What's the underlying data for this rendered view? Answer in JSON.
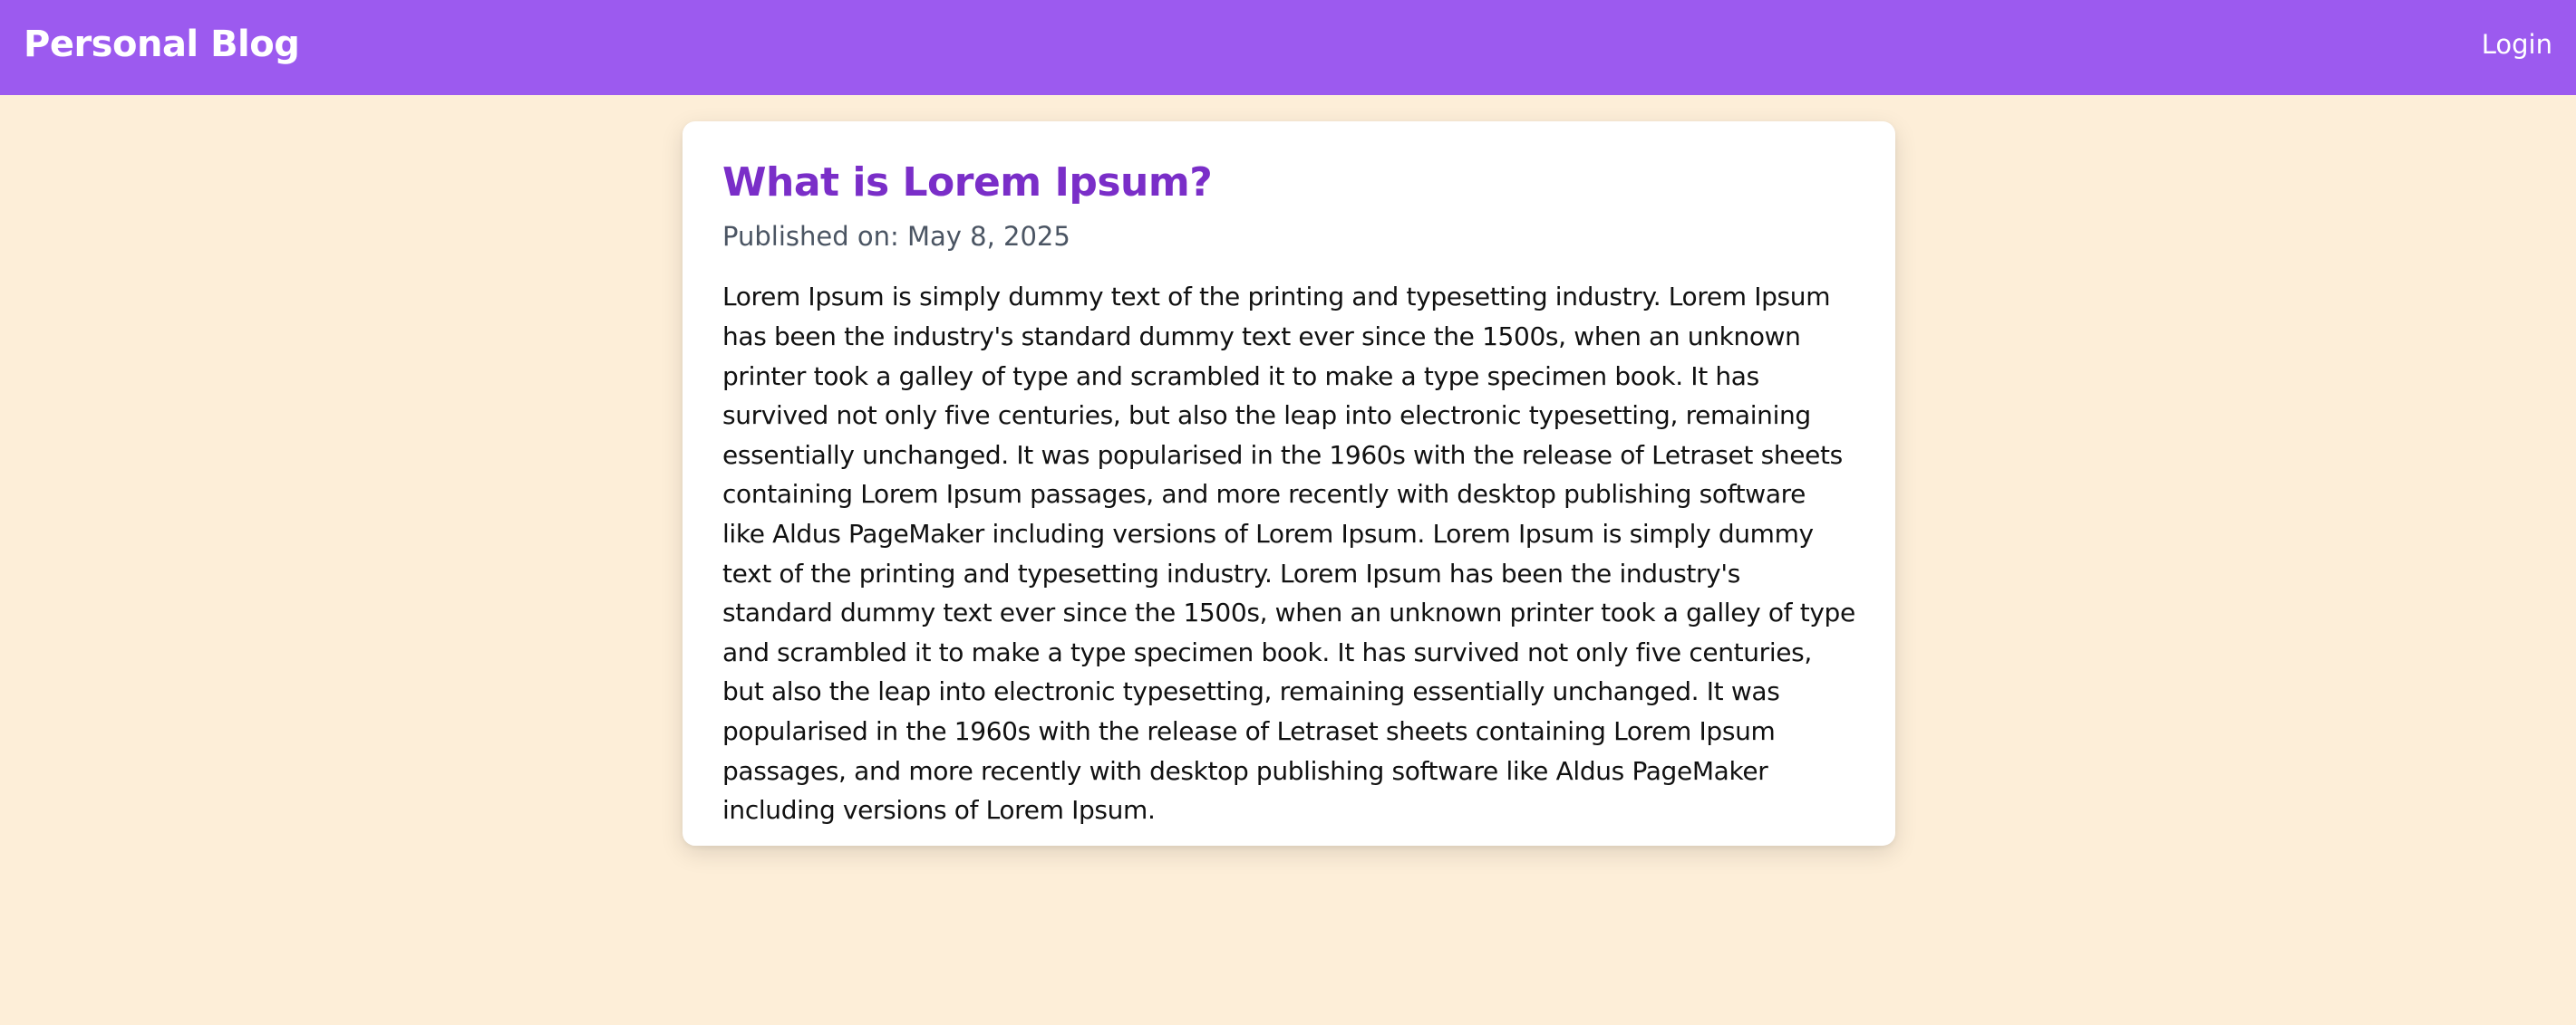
{
  "header": {
    "brand": "Personal Blog",
    "login_label": "Login"
  },
  "post": {
    "title": "What is Lorem Ipsum?",
    "published": "Published on: May 8, 2025",
    "body": "Lorem Ipsum is simply dummy text of the printing and typesetting industry. Lorem Ipsum has been the industry's standard dummy text ever since the 1500s, when an unknown printer took a galley of type and scrambled it to make a type specimen book. It has survived not only five centuries, but also the leap into electronic typesetting, remaining essentially unchanged. It was popularised in the 1960s with the release of Letraset sheets containing Lorem Ipsum passages, and more recently with desktop publishing software like Aldus PageMaker including versions of Lorem Ipsum. Lorem Ipsum is simply dummy text of the printing and typesetting industry. Lorem Ipsum has been the industry's standard dummy text ever since the 1500s, when an unknown printer took a galley of type and scrambled it to make a type specimen book. It has survived not only five centuries, but also the leap into electronic typesetting, remaining essentially unchanged. It was popularised in the 1960s with the release of Letraset sheets containing Lorem Ipsum passages, and more recently with desktop publishing software like Aldus PageMaker including versions of Lorem Ipsum."
  },
  "colors": {
    "navbar": "#9c5aef",
    "page_background": "#fdeed8",
    "title": "#7a2ec8",
    "date": "#4b5563",
    "card": "#ffffff"
  }
}
